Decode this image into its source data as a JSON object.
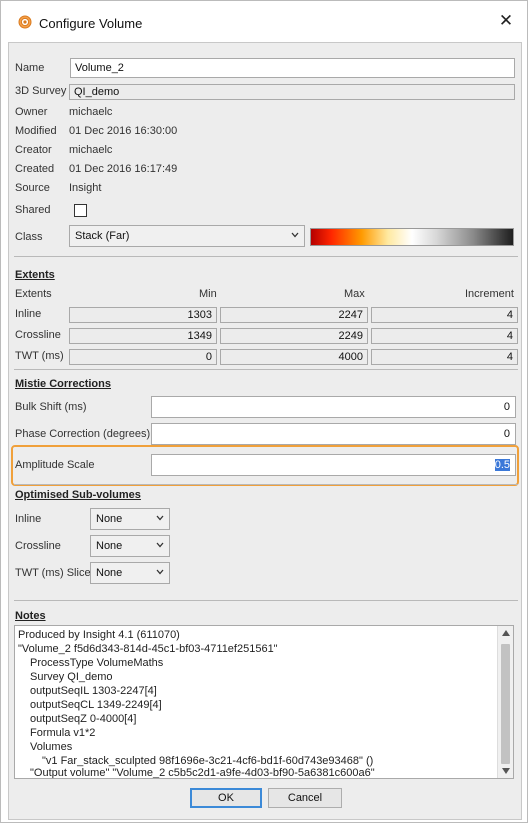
{
  "window": {
    "title": "Configure Volume",
    "app_icon": "volume-gear-icon",
    "close_icon": "close-icon"
  },
  "props": {
    "name_label": "Name",
    "name_value": "Volume_2",
    "survey_label": "3D Survey",
    "survey_value": "QI_demo",
    "owner_label": "Owner",
    "owner_value": "michaelc",
    "modified_label": "Modified",
    "modified_value": "01 Dec 2016 16:30:00",
    "creator_label": "Creator",
    "creator_value": "michaelc",
    "created_label": "Created",
    "created_value": "01 Dec 2016 16:17:49",
    "source_label": "Source",
    "source_value": "Insight",
    "shared_label": "Shared",
    "shared_checked": false,
    "class_label": "Class",
    "class_value": "Stack (Far)"
  },
  "extents": {
    "title": "Extents",
    "row_header": "Extents",
    "min_header": "Min",
    "max_header": "Max",
    "inc_header": "Increment",
    "rows": [
      {
        "label": "Inline",
        "min": "1303",
        "max": "2247",
        "inc": "4"
      },
      {
        "label": "Crossline",
        "min": "1349",
        "max": "2249",
        "inc": "4"
      },
      {
        "label": "TWT (ms)",
        "min": "0",
        "max": "4000",
        "inc": "4"
      }
    ]
  },
  "mistie": {
    "title": "Mistie Corrections",
    "bulk_label": "Bulk Shift (ms)",
    "bulk_value": "0",
    "phase_label": "Phase Correction (degrees)",
    "phase_value": "0",
    "amp_label": "Amplitude Scale",
    "amp_value": "0.5"
  },
  "subvolumes": {
    "title": "Optimised Sub-volumes",
    "inline_label": "Inline",
    "inline_value": "None",
    "crossline_label": "Crossline",
    "crossline_value": "None",
    "twt_label": "TWT (ms) Slice",
    "twt_value": "None"
  },
  "notes": {
    "title": "Notes",
    "lines": [
      "Produced by Insight 4.1 (611070)",
      "\"Volume_2 f5d6d343-814d-45c1-bf03-4711ef251561\"",
      "ProcessType VolumeMaths",
      "Survey QI_demo",
      "outputSeqIL 1303-2247[4]",
      "outputSeqCL 1349-2249[4]",
      "outputSeqZ 0-4000[4]",
      "Formula v1*2",
      "Volumes",
      "\"v1 Far_stack_sculpted 98f1696e-3c21-4cf6-bd1f-60d743e93468\" ()",
      "\"Output volume\" \"Volume_2 c5b5c2d1-a9fe-4d03-bf90-5a6381c600a6\""
    ]
  },
  "buttons": {
    "ok": "OK",
    "cancel": "Cancel"
  },
  "colors": {
    "highlight": "#f0a03a",
    "selection": "#3b78d8",
    "default_button_border": "#3c8ad8"
  }
}
